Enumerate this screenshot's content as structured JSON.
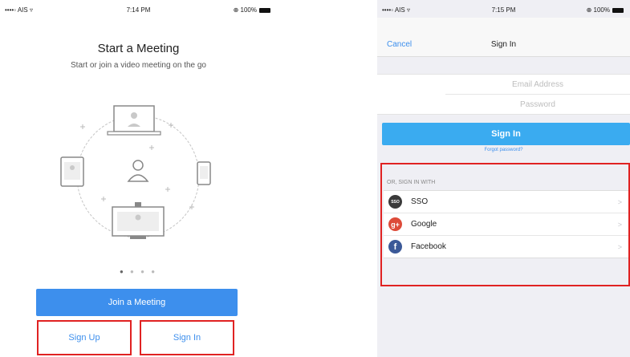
{
  "left_screen": {
    "status": {
      "carrier": "••••◦ AIS ▿",
      "time": "7:14 PM",
      "battery": "⊕ 100%"
    },
    "title": "Start a Meeting",
    "subtitle": "Start or join a video meeting on the go",
    "page_dots": [
      "●",
      "●",
      "●",
      "●"
    ],
    "join_button": "Join a Meeting",
    "signup_button": "Sign Up",
    "signin_button": "Sign In"
  },
  "right_screen": {
    "status": {
      "carrier": "••••◦ AIS ▿",
      "time": "7:15 PM",
      "battery": "⊕ 100%"
    },
    "nav": {
      "cancel": "Cancel",
      "title": "Sign In"
    },
    "email_placeholder": "Email Address",
    "password_placeholder": "Password",
    "signin_button": "Sign In",
    "forgot_link": "Forgot password?",
    "or_sign_in_with": "OR, SIGN IN WITH",
    "providers": [
      {
        "label": "SSO",
        "icon": "sso-icon",
        "icon_text": "SSO",
        "color": "#3a3a3a"
      },
      {
        "label": "Google",
        "icon": "google-plus-icon",
        "icon_text": "g+",
        "color": "#dd4b39"
      },
      {
        "label": "Facebook",
        "icon": "facebook-icon",
        "icon_text": "f",
        "color": "#3b5998"
      }
    ],
    "chevron": ">"
  },
  "colors": {
    "accent_blue": "#3d8fed",
    "signin_blue": "#3aabf0",
    "highlight_red": "#e02222"
  }
}
